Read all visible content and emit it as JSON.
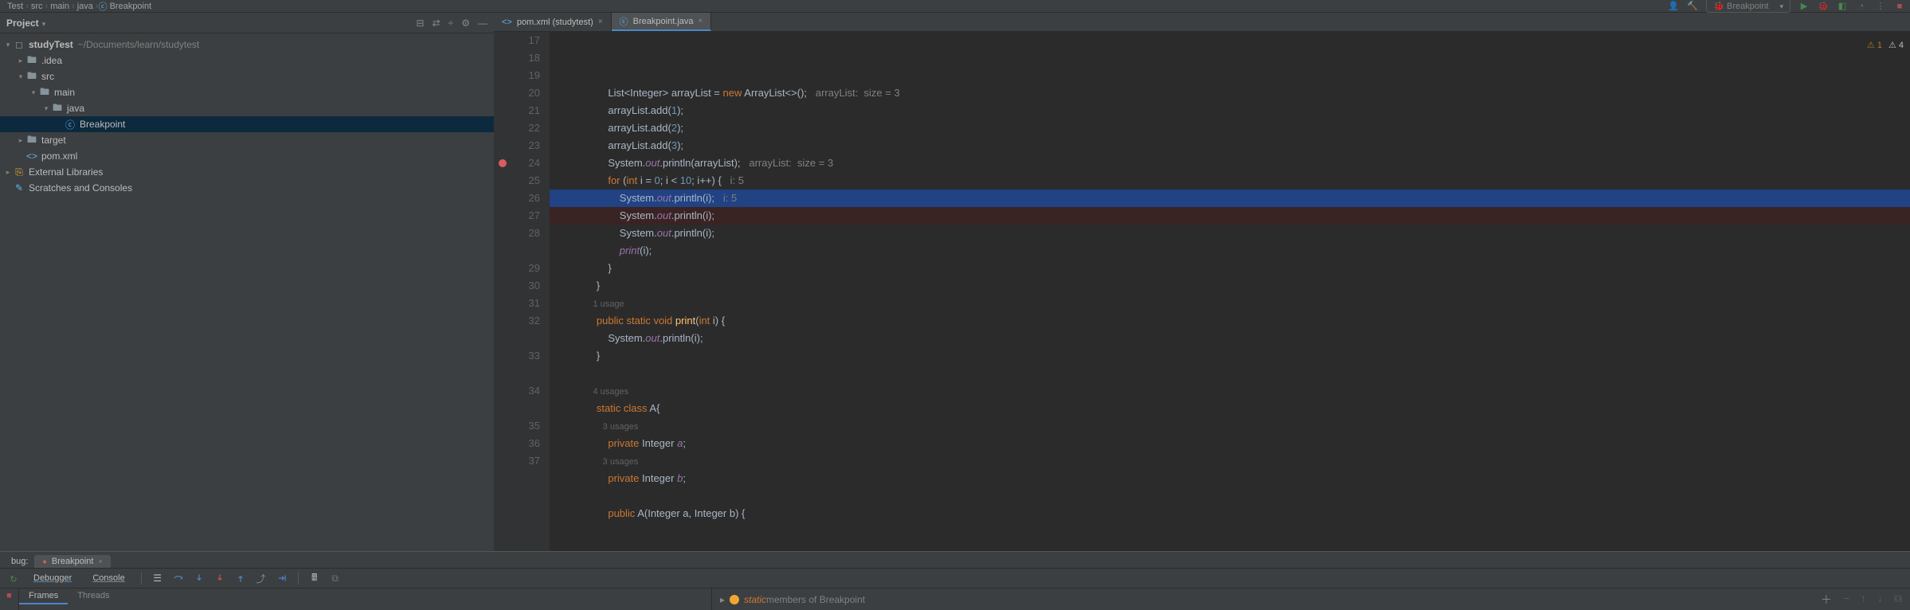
{
  "topbar": {
    "path": [
      "Test",
      "src",
      "main",
      "java",
      "Breakpoint"
    ],
    "fileIcon": "java-class",
    "runConfig": "Breakpoint",
    "warnCount": "1",
    "errCount": "4"
  },
  "projectPanel": {
    "title": "Project",
    "root": "studyTest",
    "rootHint": "~/Documents/learn/studytest",
    "tree": [
      {
        "depth": 0,
        "arrow": "▾",
        "icon": "module",
        "label": "studyTest",
        "bold": true,
        "hint": "~/Documents/learn/studytest"
      },
      {
        "depth": 1,
        "arrow": "▸",
        "icon": "dir",
        "label": ".idea"
      },
      {
        "depth": 1,
        "arrow": "▾",
        "icon": "dir",
        "label": "src"
      },
      {
        "depth": 2,
        "arrow": "▾",
        "icon": "dir",
        "label": "main"
      },
      {
        "depth": 3,
        "arrow": "▾",
        "icon": "dir",
        "label": "java"
      },
      {
        "depth": 4,
        "arrow": " ",
        "icon": "class",
        "label": "Breakpoint",
        "selected": true
      },
      {
        "depth": 1,
        "arrow": "▸",
        "icon": "dir",
        "label": "target"
      },
      {
        "depth": 1,
        "arrow": " ",
        "icon": "xml",
        "label": "pom.xml"
      },
      {
        "depth": 0,
        "arrow": "▸",
        "icon": "lib",
        "label": "External Libraries"
      },
      {
        "depth": 0,
        "arrow": " ",
        "icon": "scratch",
        "label": "Scratches and Consoles"
      }
    ]
  },
  "editor": {
    "tabs": [
      {
        "icon": "xml",
        "label": "pom.xml (studytest)",
        "active": false
      },
      {
        "icon": "class",
        "label": "Breakpoint.java",
        "active": true
      }
    ],
    "lines": [
      {
        "n": 17,
        "tokens": [
          [
            "plain",
            "            "
          ],
          [
            "plain",
            "List<Integer> arrayList = "
          ],
          [
            "kw",
            "new"
          ],
          [
            "plain",
            " ArrayList<>();   "
          ],
          [
            "hint",
            "arrayList:  size = 3"
          ]
        ]
      },
      {
        "n": 18,
        "tokens": [
          [
            "plain",
            "            arrayList.add("
          ],
          [
            "num",
            "1"
          ],
          [
            "plain",
            ");"
          ]
        ]
      },
      {
        "n": 19,
        "tokens": [
          [
            "plain",
            "            arrayList.add("
          ],
          [
            "num",
            "2"
          ],
          [
            "plain",
            ");"
          ]
        ]
      },
      {
        "n": 20,
        "tokens": [
          [
            "plain",
            "            arrayList.add("
          ],
          [
            "num",
            "3"
          ],
          [
            "plain",
            ");"
          ]
        ]
      },
      {
        "n": 21,
        "tokens": [
          [
            "plain",
            "            System."
          ],
          [
            "static",
            "out"
          ],
          [
            "plain",
            ".println(arrayList);   "
          ],
          [
            "hint",
            "arrayList:  size = 3"
          ]
        ]
      },
      {
        "n": 22,
        "tokens": [
          [
            "plain",
            "            "
          ],
          [
            "kw",
            "for"
          ],
          [
            "plain",
            " ("
          ],
          [
            "kw",
            "int"
          ],
          [
            "plain",
            " "
          ],
          [
            "plain",
            "i"
          ],
          [
            "plain",
            " = "
          ],
          [
            "num",
            "0"
          ],
          [
            "plain",
            "; "
          ],
          [
            "plain",
            "i"
          ],
          [
            "plain",
            " < "
          ],
          [
            "num",
            "10"
          ],
          [
            "plain",
            "; i++) {   "
          ],
          [
            "hint",
            "i: 5"
          ]
        ]
      },
      {
        "n": 23,
        "class": "exec",
        "tokens": [
          [
            "plain",
            "                System."
          ],
          [
            "static",
            "out"
          ],
          [
            "plain",
            ".println("
          ],
          [
            "plain",
            "i"
          ],
          [
            "plain",
            ");   "
          ],
          [
            "hint",
            "i: 5"
          ]
        ]
      },
      {
        "n": 24,
        "class": "bpline",
        "bp": true,
        "tokens": [
          [
            "plain",
            "                System."
          ],
          [
            "static",
            "out"
          ],
          [
            "plain",
            ".println("
          ],
          [
            "plain",
            "i"
          ],
          [
            "plain",
            ");"
          ]
        ]
      },
      {
        "n": 25,
        "tokens": [
          [
            "plain",
            "                System."
          ],
          [
            "static",
            "out"
          ],
          [
            "plain",
            ".println("
          ],
          [
            "plain",
            "i"
          ],
          [
            "plain",
            ");"
          ]
        ]
      },
      {
        "n": 26,
        "tokens": [
          [
            "plain",
            "                "
          ],
          [
            "static",
            "print"
          ],
          [
            "plain",
            "("
          ],
          [
            "plain",
            "i"
          ],
          [
            "plain",
            ");"
          ]
        ]
      },
      {
        "n": 27,
        "tokens": [
          [
            "plain",
            "            }"
          ]
        ]
      },
      {
        "n": 28,
        "tokens": [
          [
            "plain",
            "        }"
          ]
        ]
      },
      {
        "n": "",
        "tokens": [
          [
            "usages",
            "        1 usage"
          ]
        ]
      },
      {
        "n": 29,
        "tokens": [
          [
            "plain",
            "        "
          ],
          [
            "kw",
            "public static void"
          ],
          [
            "plain",
            " "
          ],
          [
            "mth",
            "print"
          ],
          [
            "plain",
            "("
          ],
          [
            "kw",
            "int"
          ],
          [
            "plain",
            " i) {"
          ]
        ]
      },
      {
        "n": 30,
        "tokens": [
          [
            "plain",
            "            System."
          ],
          [
            "static",
            "out"
          ],
          [
            "plain",
            ".println(i);"
          ]
        ]
      },
      {
        "n": 31,
        "tokens": [
          [
            "plain",
            "        }"
          ]
        ]
      },
      {
        "n": 32,
        "tokens": [
          [
            "plain",
            ""
          ]
        ]
      },
      {
        "n": "",
        "tokens": [
          [
            "usages",
            "        4 usages"
          ]
        ]
      },
      {
        "n": 33,
        "tokens": [
          [
            "plain",
            "        "
          ],
          [
            "kw",
            "static class"
          ],
          [
            "plain",
            " "
          ],
          [
            "plain",
            "A"
          ],
          [
            "plain",
            "{"
          ]
        ]
      },
      {
        "n": "",
        "tokens": [
          [
            "usages",
            "            3 usages"
          ]
        ]
      },
      {
        "n": 34,
        "tokens": [
          [
            "plain",
            "            "
          ],
          [
            "kw",
            "private"
          ],
          [
            "plain",
            " Integer "
          ],
          [
            "field",
            "a"
          ],
          [
            "plain",
            ";"
          ]
        ]
      },
      {
        "n": "",
        "tokens": [
          [
            "usages",
            "            3 usages"
          ]
        ]
      },
      {
        "n": 35,
        "tokens": [
          [
            "plain",
            "            "
          ],
          [
            "kw",
            "private"
          ],
          [
            "plain",
            " Integer "
          ],
          [
            "field",
            "b"
          ],
          [
            "plain",
            ";"
          ]
        ]
      },
      {
        "n": 36,
        "tokens": [
          [
            "plain",
            ""
          ]
        ]
      },
      {
        "n": 37,
        "tokens": [
          [
            "plain",
            "            "
          ],
          [
            "kw",
            "public"
          ],
          [
            "plain",
            " "
          ],
          [
            "plain",
            "A"
          ],
          [
            "plain",
            "(Integer a, Integer b) {"
          ]
        ]
      }
    ],
    "warnBadge": "1",
    "hintBadge": "4"
  },
  "debugPanel": {
    "label": "bug:",
    "chip": "Breakpoint",
    "tabs": {
      "debugger": "Debugger",
      "console": "Console"
    },
    "frameTabs": {
      "frames": "Frames",
      "threads": "Threads"
    },
    "vars": {
      "staticKw": "static",
      "rest": " members of Breakpoint"
    }
  }
}
